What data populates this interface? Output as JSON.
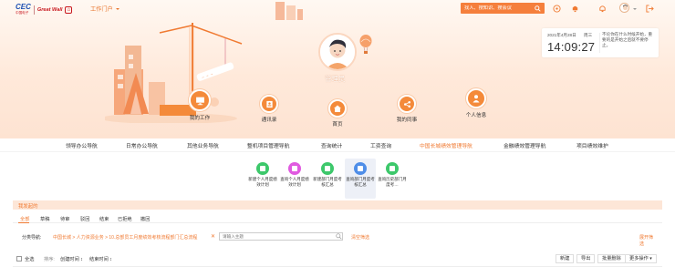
{
  "topbar": {
    "logo_cec": "CEC",
    "logo_cec_sub": "中国电子",
    "logo_gw": "Great Wall",
    "portal_label": "工作门户",
    "search_placeholder": "找人、搜知识、搜会议"
  },
  "clock": {
    "date": "2021年4月28日",
    "weekday": "周三",
    "time": "14:09:27",
    "quote": "不论你在什么时候开始，重要的是开始之后就不要停止。"
  },
  "profile": {
    "name": "管理员"
  },
  "circle_nav": [
    {
      "label": "我的工作",
      "icon": "monitor-icon"
    },
    {
      "label": "通讯录",
      "icon": "contacts-icon"
    },
    {
      "label": "首页",
      "icon": "home-icon"
    },
    {
      "label": "我的同事",
      "icon": "share-icon"
    },
    {
      "label": "个人信息",
      "icon": "person-icon"
    }
  ],
  "menu": [
    {
      "label": "领导办公导航"
    },
    {
      "label": "日常办公导航"
    },
    {
      "label": "其他业务导航"
    },
    {
      "label": "整机项目管理导航"
    },
    {
      "label": "查询统计"
    },
    {
      "label": "工资查询"
    },
    {
      "label": "中国长城绩效管理导航",
      "active": true
    },
    {
      "label": "金融绩效管理导航"
    },
    {
      "label": "项目绩效维护"
    }
  ],
  "tiles": [
    {
      "label": "新建个人月度绩效计划",
      "color": "#3dc86b"
    },
    {
      "label": "查询个人月度绩效计划",
      "color": "#e05ae0"
    },
    {
      "label": "新建部门月度考核汇总",
      "color": "#3dc86b"
    },
    {
      "label": "查询部门月度考核汇总",
      "color": "#4f8ee8",
      "active": true
    },
    {
      "label": "查询历史部门月度考…",
      "color": "#3dc86b"
    }
  ],
  "panel": {
    "title": "我发起的",
    "tabs": [
      "全部",
      "草稿",
      "待审",
      "驳回",
      "结束",
      "已拒绝",
      "撤回"
    ],
    "filter_label": "分类导航:",
    "filter_path": "中国长城 > 人力资源业务 > 10.总部员工月度绩效考核流程部门汇总流程",
    "filter_clear_x": "✕",
    "filter_input_placeholder": "请输入主题",
    "clear_filter": "清空筛选",
    "expand": "展开筛选",
    "select_all": "全选",
    "sort_label": "排序:",
    "sort_created": "创建时间 ↕",
    "sort_updated": "结束时间 ↕",
    "buttons": {
      "new": "新建",
      "export": "导出",
      "batch_delete": "批量删除",
      "more": "更多操作 ▾"
    }
  },
  "colors": {
    "accent": "#f07a32",
    "header_bg": "#fde3d2"
  }
}
